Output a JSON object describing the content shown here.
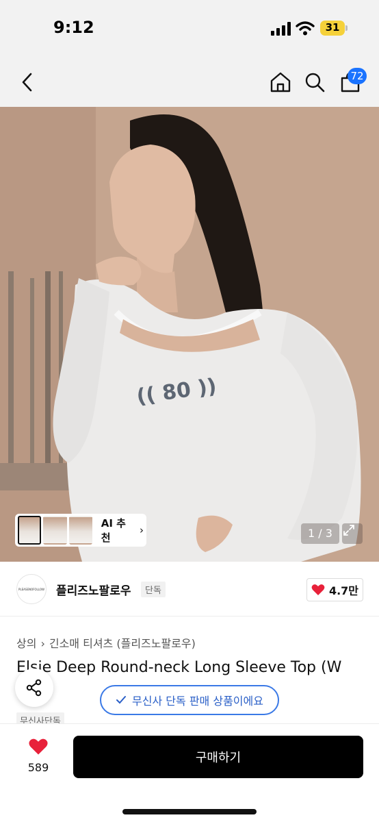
{
  "status_bar": {
    "time": "9:12",
    "battery": "31",
    "icons": [
      "signal-icon",
      "wifi-icon",
      "battery-icon"
    ]
  },
  "nav": {
    "icons": [
      "back-icon",
      "home-icon",
      "search-icon",
      "cart-icon"
    ],
    "cart_count": "72",
    "badge_color": "#1a73ff"
  },
  "gallery": {
    "ai_label": "AI 추천",
    "page_indicator": "1 / 3",
    "current_page": 1,
    "total_pages": 3
  },
  "brand": {
    "name": "플리즈노팔로우",
    "tag": "단독",
    "likes": "4.7만",
    "logo_text": "PLEASENOFOLLOW"
  },
  "product": {
    "breadcrumb": [
      "상의",
      "긴소매 티셔츠 (플리즈노팔로우)"
    ],
    "title": "Elsie Deep Round-neck Long Sleeve Top (W",
    "exclusive_badge": "무신사단독",
    "exclusive_notice": "무신사 단독 판매 상품이에요",
    "notice_color": "#3a79e6"
  },
  "bottom_bar": {
    "wish_count": "589",
    "buy_label": "구매하기",
    "heart_color": "#e8213a"
  }
}
